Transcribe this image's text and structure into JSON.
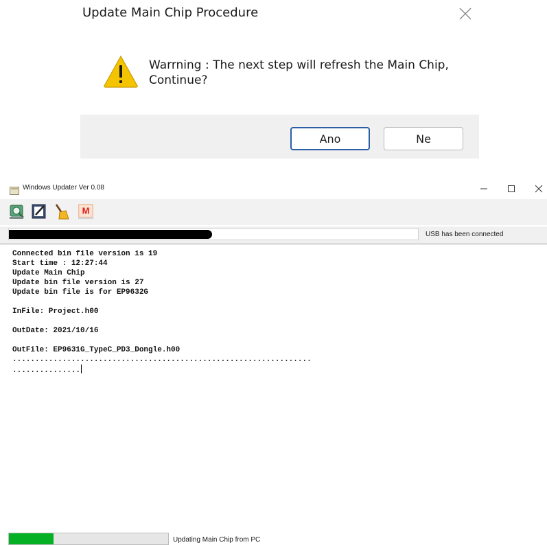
{
  "dialog": {
    "title": "Update Main Chip Procedure",
    "message_line1": "Warrning : The next step will refresh the Main Chip,",
    "message_line2": "Continue?",
    "icon": "warning-triangle-icon",
    "buttons": {
      "yes": "Ano",
      "no": "Ne"
    }
  },
  "updater": {
    "window_title": "Windows Updater Ver 0.08",
    "toolbar_icons": [
      "chip-read-icon",
      "edit-icon",
      "broom-icon",
      "mstar-logo-icon"
    ],
    "usb_status": "USB has been connected",
    "log_lines": [
      "Connected bin file version is 19",
      "Start time : 12:27:44",
      "Update Main Chip",
      "Update bin file version is 27",
      "Update bin file is for EP9632G",
      "",
      "InFile: Project.h00",
      "",
      "OutDate: 2021/10/16",
      "",
      "OutFile: EP9631G_TypeC_PD3_Dongle.h00",
      "..................................................................",
      "..............."
    ],
    "progress_fraction": 0.28,
    "status_text": "Updating Main Chip from PC"
  },
  "colors": {
    "progress": "#06b025",
    "primary_border": "#2c5ea8",
    "warning": "#f5c400"
  }
}
